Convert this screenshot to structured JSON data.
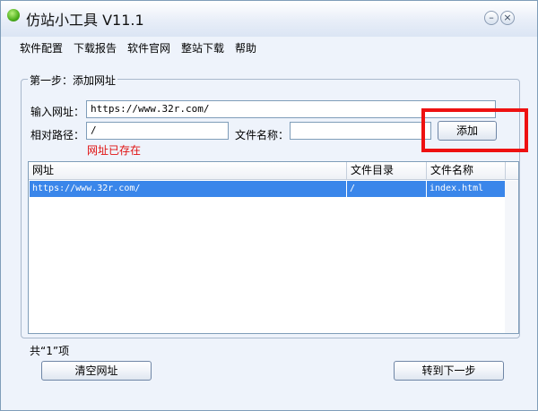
{
  "window": {
    "title": "仿站小工具 V11.1",
    "min_glyph": "–",
    "close_glyph": "×"
  },
  "menu": {
    "items": [
      "软件配置",
      "下载报告",
      "软件官网",
      "整站下载",
      "帮助"
    ]
  },
  "step": {
    "title": "第一步：添加网址",
    "url_label": "输入网址：",
    "url_value": "https://www.32r.com/",
    "path_label": "相对路径：",
    "path_value": "/",
    "filename_label": "文件名称：",
    "filename_value": "",
    "add_label": "添加",
    "error_text": "网址已存在"
  },
  "table": {
    "columns": [
      "网址",
      "文件目录",
      "文件名称"
    ],
    "rows": [
      [
        "https://www.32r.com/",
        "/",
        "index.html"
      ]
    ]
  },
  "footer": {
    "count_text": "共“1”项",
    "clear_label": "清空网址",
    "next_label": "转到下一步"
  },
  "colors": {
    "highlight": "#ee1111",
    "selection": "#3a86ea",
    "error": "#e01010"
  },
  "icons": {
    "app": "green-circle-icon",
    "minimize": "minimize-icon",
    "close": "close-icon"
  }
}
